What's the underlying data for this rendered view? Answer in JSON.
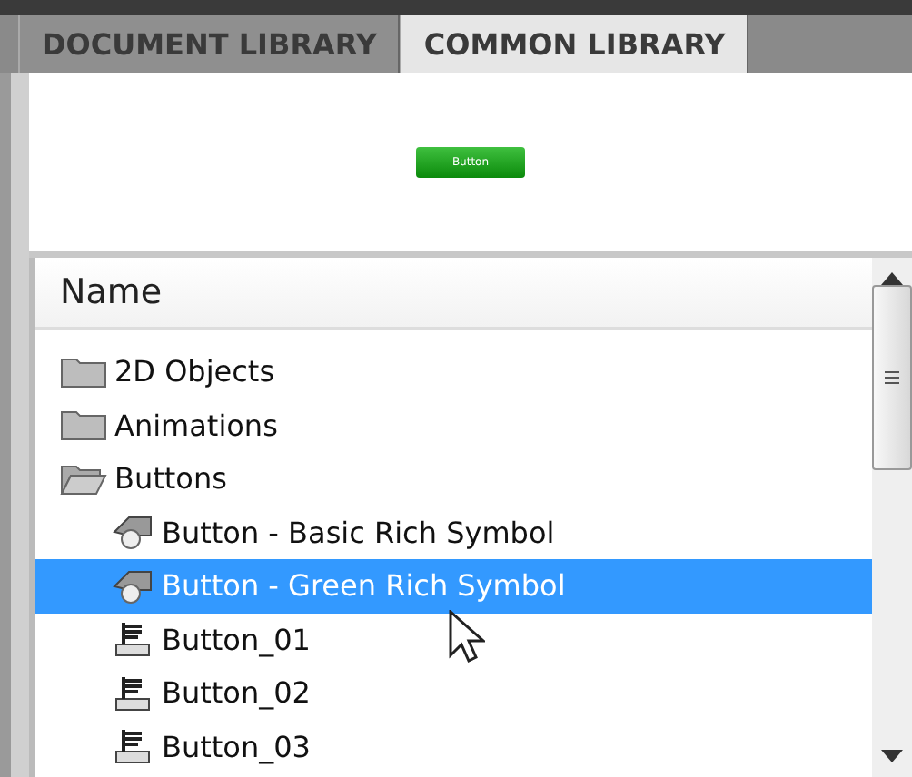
{
  "tabs": [
    {
      "label": "DOCUMENT LIBRARY",
      "selected": false
    },
    {
      "label": "COMMON LIBRARY",
      "selected": true
    }
  ],
  "preview": {
    "button_label": "Button"
  },
  "list": {
    "column": "Name",
    "items": [
      {
        "label": "2D Objects",
        "kind": "folder",
        "expanded": false,
        "selected": false
      },
      {
        "label": "Animations",
        "kind": "folder",
        "expanded": false,
        "selected": false
      },
      {
        "label": "Buttons",
        "kind": "folder",
        "expanded": true,
        "selected": false,
        "children": [
          {
            "label": "Button - Basic Rich Symbol",
            "kind": "rich",
            "selected": false
          },
          {
            "label": "Button - Green Rich Symbol",
            "kind": "rich",
            "selected": true
          },
          {
            "label": "Button_01",
            "kind": "button",
            "selected": false
          },
          {
            "label": "Button_02",
            "kind": "button",
            "selected": false
          },
          {
            "label": "Button_03",
            "kind": "button",
            "selected": false
          }
        ]
      }
    ]
  }
}
